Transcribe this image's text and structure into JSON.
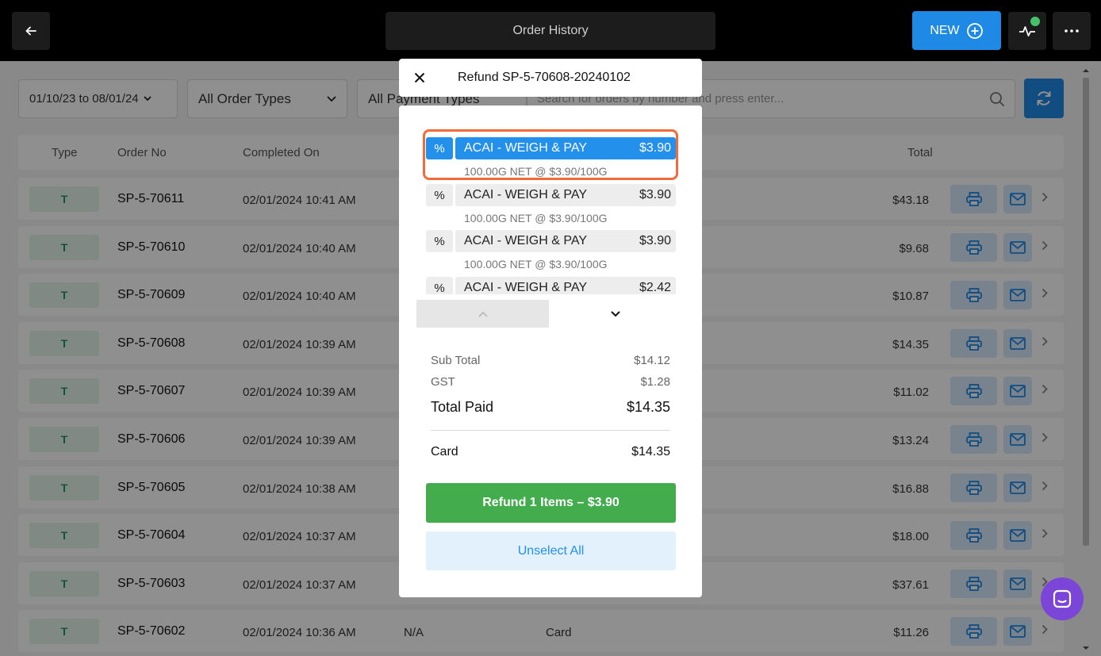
{
  "header": {
    "title": "Order History",
    "new_label": "NEW"
  },
  "filters": {
    "date_range": "01/10/23 to 08/01/24",
    "order_types": "All Order Types",
    "payment_types": "All Payment Types",
    "search_placeholder": "Search for orders by number and press enter..."
  },
  "table": {
    "columns": {
      "type": "Type",
      "order_no": "Order No",
      "completed_on": "Completed On",
      "total": "Total"
    },
    "rows": [
      {
        "type": "T",
        "order_no": "SP-5-70611",
        "completed_on": "02/01/2024 10:41 AM",
        "ref": "",
        "payment": "",
        "total": "$43.18"
      },
      {
        "type": "T",
        "order_no": "SP-5-70610",
        "completed_on": "02/01/2024 10:40 AM",
        "ref": "",
        "payment": "",
        "total": "$9.68"
      },
      {
        "type": "T",
        "order_no": "SP-5-70609",
        "completed_on": "02/01/2024 10:40 AM",
        "ref": "",
        "payment": "",
        "total": "$10.87"
      },
      {
        "type": "T",
        "order_no": "SP-5-70608",
        "completed_on": "02/01/2024 10:39 AM",
        "ref": "",
        "payment": "",
        "total": "$14.35"
      },
      {
        "type": "T",
        "order_no": "SP-5-70607",
        "completed_on": "02/01/2024 10:39 AM",
        "ref": "",
        "payment": "",
        "total": "$11.02"
      },
      {
        "type": "T",
        "order_no": "SP-5-70606",
        "completed_on": "02/01/2024 10:39 AM",
        "ref": "",
        "payment": "",
        "total": "$13.24"
      },
      {
        "type": "T",
        "order_no": "SP-5-70605",
        "completed_on": "02/01/2024 10:38 AM",
        "ref": "",
        "payment": "",
        "total": "$16.88"
      },
      {
        "type": "T",
        "order_no": "SP-5-70604",
        "completed_on": "02/01/2024 10:37 AM",
        "ref": "",
        "payment": "",
        "total": "$18.00"
      },
      {
        "type": "T",
        "order_no": "SP-5-70603",
        "completed_on": "02/01/2024 10:37 AM",
        "ref": "",
        "payment": "",
        "total": "$37.61"
      },
      {
        "type": "T",
        "order_no": "SP-5-70602",
        "completed_on": "02/01/2024 10:36 AM",
        "ref": "N/A",
        "payment": "Card",
        "total": "$11.26"
      }
    ]
  },
  "modal": {
    "title": "Refund SP-5-70608-20240102",
    "items": [
      {
        "pct": "%",
        "name": "ACAI - WEIGH & PAY",
        "price": "$3.90",
        "detail": "100.00G NET @ $3.90/100G",
        "selected": true
      },
      {
        "pct": "%",
        "name": "ACAI - WEIGH & PAY",
        "price": "$3.90",
        "detail": "100.00G NET @ $3.90/100G",
        "selected": false
      },
      {
        "pct": "%",
        "name": "ACAI - WEIGH & PAY",
        "price": "$3.90",
        "detail": "100.00G NET @ $3.90/100G",
        "selected": false
      },
      {
        "pct": "%",
        "name": "ACAI - WEIGH & PAY",
        "price": "$2.42",
        "detail": "",
        "selected": false
      }
    ],
    "summary": {
      "subtotal_label": "Sub Total",
      "subtotal_value": "$14.12",
      "gst_label": "GST",
      "gst_value": "$1.28",
      "total_label": "Total Paid",
      "total_value": "$14.35",
      "card_label": "Card",
      "card_value": "$14.35"
    },
    "refund_label": "Refund 1 Items – $3.90",
    "unselect_label": "Unselect All"
  },
  "icons": {
    "back": "arrow-left-icon",
    "new": "plus-circle-icon",
    "activity": "pulse-icon",
    "more": "dots-icon",
    "search": "search-icon",
    "refresh": "refresh-icon",
    "print": "printer-icon",
    "mail": "mail-icon",
    "close": "close-icon",
    "chat": "chat-icon"
  },
  "colors": {
    "accent": "#1f8ae6",
    "success": "#43ad4e",
    "highlight_ring": "#f26b3a",
    "chat": "#7b45d8"
  }
}
